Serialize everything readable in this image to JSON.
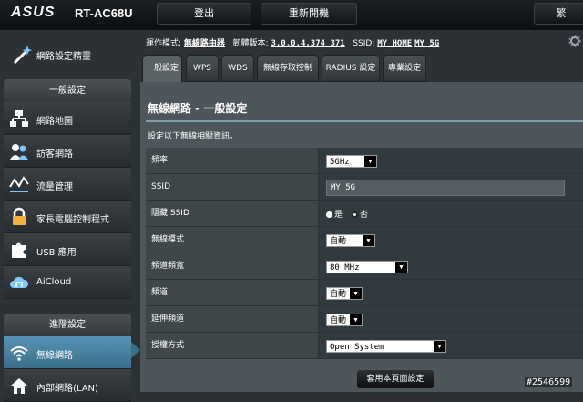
{
  "header": {
    "brand": "ASUS",
    "model": "RT-AC68U",
    "logout_label": "登出",
    "reboot_label": "重新開機",
    "lang_label": "繁"
  },
  "sidebar": {
    "wizard_label": "網路設定精靈",
    "general_head": "一般設定",
    "general_items": [
      {
        "label": "網路地圖",
        "icon": "network-map-icon"
      },
      {
        "label": "訪客網路",
        "icon": "guest-network-icon"
      },
      {
        "label": "流量管理",
        "icon": "traffic-icon"
      },
      {
        "label": "家長電腦控制程式",
        "icon": "lock-icon"
      },
      {
        "label": "USB 應用",
        "icon": "puzzle-icon"
      },
      {
        "label": "AiCloud",
        "icon": "cloud-icon"
      }
    ],
    "advanced_head": "進階設定",
    "advanced_items": [
      {
        "label": "無線網路",
        "icon": "wifi-icon",
        "active": true
      },
      {
        "label": "內部網路(LAN)",
        "icon": "home-icon"
      }
    ]
  },
  "status": {
    "mode_label": "運作模式:",
    "mode_value": "無線路由器",
    "fw_label": "韌體版本:",
    "fw_value": "3.0.0.4.374_371",
    "ssid_label": "SSID:",
    "ssid1": "MY_HOME",
    "ssid2": "MY_5G"
  },
  "tabs": [
    "一般設定",
    "WPS",
    "WDS",
    "無線存取控制",
    "RADIUS 設定",
    "專業設定"
  ],
  "panel": {
    "title": "無線網路 - 一般設定",
    "desc": "設定以下無線相關資訊。",
    "rows": {
      "band": {
        "label": "頻率",
        "value": "5GHz"
      },
      "ssid": {
        "label": "SSID",
        "value": "MY_5G"
      },
      "hide_ssid": {
        "label": "隱藏 SSID",
        "yes": "是",
        "no": "否"
      },
      "mode": {
        "label": "無線模式",
        "value": "自動"
      },
      "bandwidth": {
        "label": "頻道頻寬",
        "value": "80 MHz"
      },
      "channel": {
        "label": "頻道",
        "value": "自動"
      },
      "ext_channel": {
        "label": "延伸頻道",
        "value": "自動"
      },
      "auth": {
        "label": "授權方式",
        "value": "Open System"
      }
    },
    "apply_label": "套用本頁面設定"
  },
  "watermark": "#2546599",
  "colors": {
    "active": "#4a86a8",
    "bg": "#2b3134",
    "panel": "#4d565a"
  }
}
